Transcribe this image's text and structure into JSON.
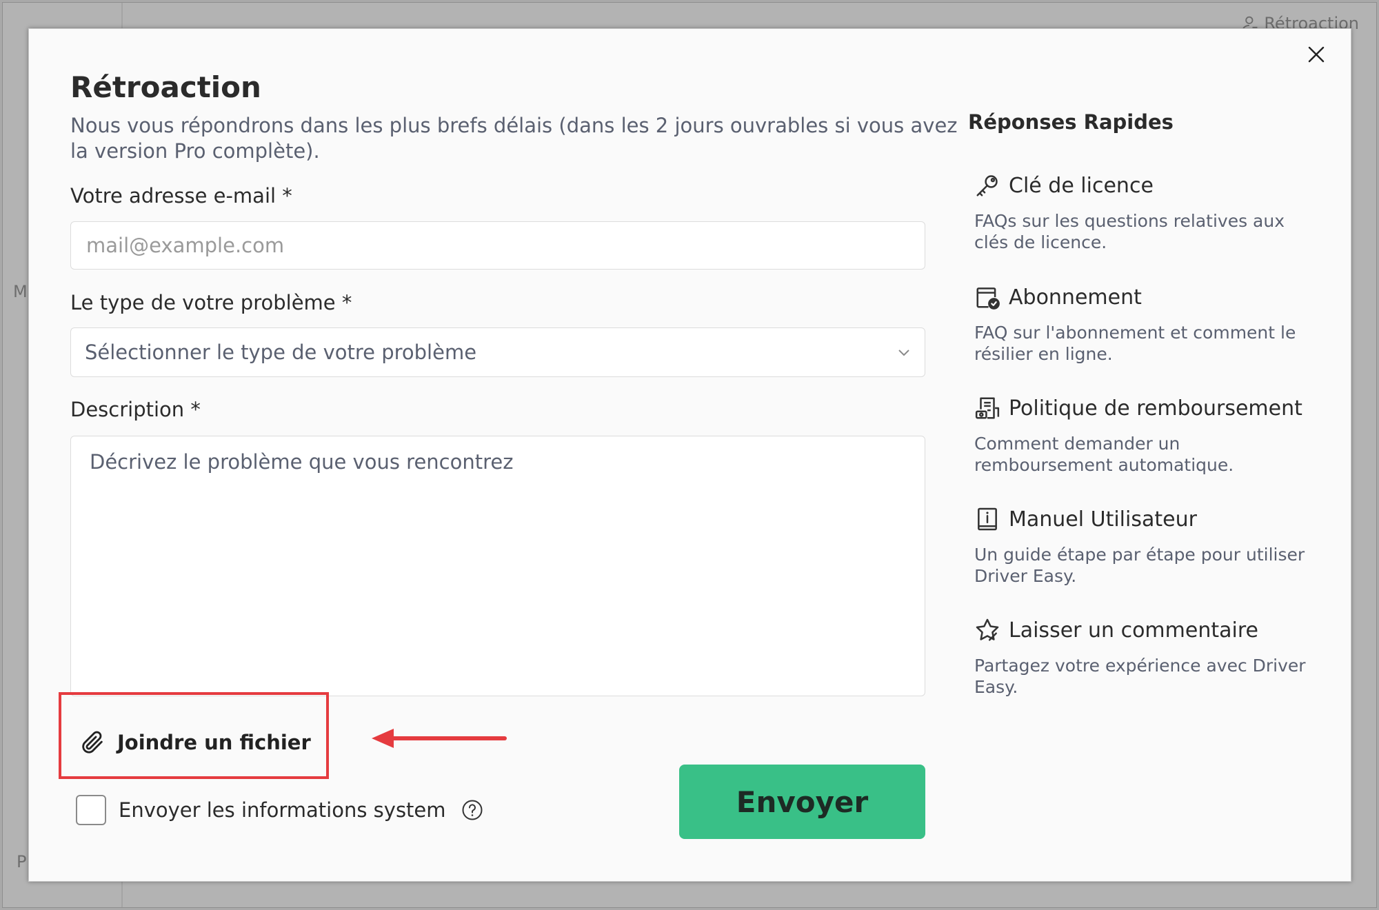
{
  "background": {
    "feedback_link": "Rétroaction",
    "letter_1": "M",
    "letter_2": "P"
  },
  "dialog": {
    "title": "Rétroaction",
    "subtitle": "Nous vous répondrons dans les plus brefs délais (dans les 2 jours ouvrables si vous avez la version Pro complète).",
    "email": {
      "label": "Votre adresse e-mail *",
      "placeholder": "mail@example.com",
      "value": ""
    },
    "problem_type": {
      "label": "Le type de votre problème *",
      "selected": "Sélectionner le type de votre problème"
    },
    "description": {
      "label": "Description *",
      "placeholder": "Décrivez le problème que vous rencontrez",
      "value": ""
    },
    "attach_label": "Joindre un fichier",
    "send_system_info": {
      "label": "Envoyer les informations system",
      "checked": false
    },
    "send_button": "Envoyer"
  },
  "quick_answers": {
    "title": "Réponses Rapides",
    "items": [
      {
        "icon": "key-icon",
        "title": "Clé de licence",
        "description": "FAQs sur les questions relatives aux clés de licence."
      },
      {
        "icon": "subscription-icon",
        "title": "Abonnement",
        "description": "FAQ sur l'abonnement et comment le résilier en ligne."
      },
      {
        "icon": "refund-icon",
        "title": "Politique de remboursement",
        "description": "Comment demander un remboursement automatique."
      },
      {
        "icon": "manual-icon",
        "title": "Manuel Utilisateur",
        "description": "Un guide étape par étape pour utiliser Driver Easy."
      },
      {
        "icon": "star-icon",
        "title": "Laisser un commentaire",
        "description": "Partagez votre expérience avec Driver Easy."
      }
    ]
  },
  "colors": {
    "accent_green": "#39c087",
    "highlight_red": "#e53b3f",
    "text_secondary": "#5a6070"
  }
}
